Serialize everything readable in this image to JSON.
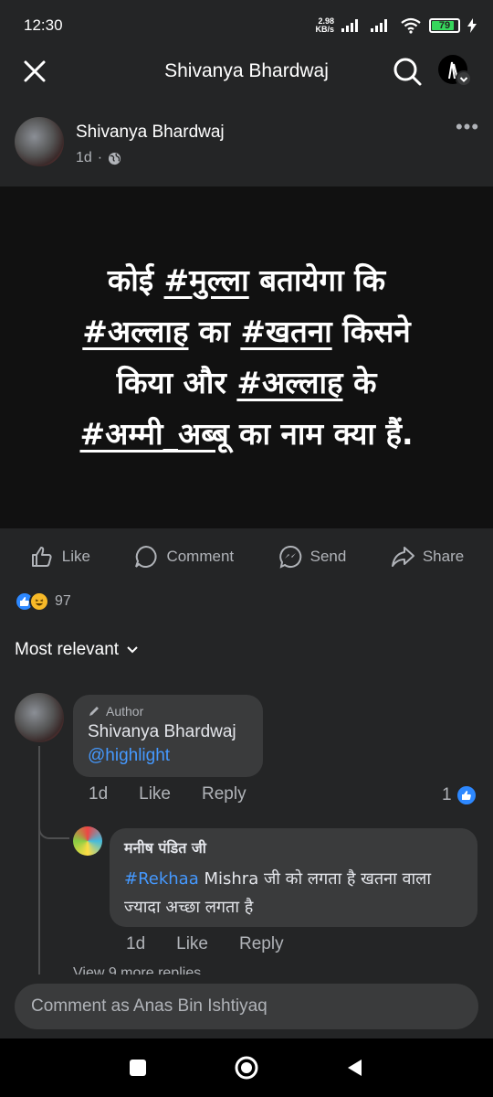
{
  "status_bar": {
    "time": "12:30",
    "net_speed_value": "2.98",
    "net_speed_unit": "KB/s",
    "battery_level": "79"
  },
  "top_bar": {
    "title": "Shivanya Bhardwaj"
  },
  "post": {
    "author": "Shivanya Bhardwaj",
    "time": "1d",
    "separator": "·",
    "privacy_icon": "globe-icon",
    "text": [
      {
        "pre": "कोई ",
        "tag": "#मुल्ला",
        "post": " बतायेगा कि"
      },
      {
        "pre": "",
        "tag": "#अल्लाह",
        "post": " का "
      },
      {
        "pre": "",
        "tag": "#खतना",
        "post": " किसने"
      },
      {
        "pre": "किया और ",
        "tag": "#अल्लाह",
        "post": " के"
      },
      {
        "pre": "",
        "tag": "#अम्मी_अब्बू",
        "post": " का नाम क्या हैं."
      }
    ],
    "text_line1_a": "कोई ",
    "text_line1_tag": "#मुल्ला",
    "text_line1_b": " बतायेगा कि",
    "text_line2_tag1": "#अल्लाह",
    "text_line2_mid": " का ",
    "text_line2_tag2": "#खतना",
    "text_line2_b": " किसने",
    "text_line3_a": "किया और ",
    "text_line3_tag": "#अल्लाह",
    "text_line3_b": " के",
    "text_line4_tag": "#अम्मी_अब्बू",
    "text_line4_b": " का नाम क्या हैं."
  },
  "actions": {
    "like": "Like",
    "comment": "Comment",
    "send": "Send",
    "share": "Share"
  },
  "reactions": {
    "count": "97",
    "types": [
      "like",
      "haha"
    ]
  },
  "sort": {
    "label": "Most relevant"
  },
  "comments": {
    "main": {
      "badge": "Author",
      "author": "Shivanya Bhardwaj",
      "mention": "@highlight",
      "time": "1d",
      "like": "Like",
      "reply": "Reply",
      "like_count": "1"
    },
    "reply": {
      "author": "मनीष पंडित जी",
      "hashtag": "#Rekhaa",
      "text_after_hashtag": " Mishra जी को लगता है खतना वाला ज्यादा अच्छा लगता है",
      "time": "1d",
      "like": "Like",
      "reply": "Reply"
    },
    "more_replies": "View 9 more replies"
  },
  "composer": {
    "placeholder": "Comment as Anas Bin Ishtiyaq"
  },
  "colors": {
    "background": "#242526",
    "bubble": "#3a3b3c",
    "accent_blue": "#2d88ff",
    "link_blue": "#4599ff",
    "secondary_text": "#b0b3b8",
    "image_bg": "#111111"
  }
}
